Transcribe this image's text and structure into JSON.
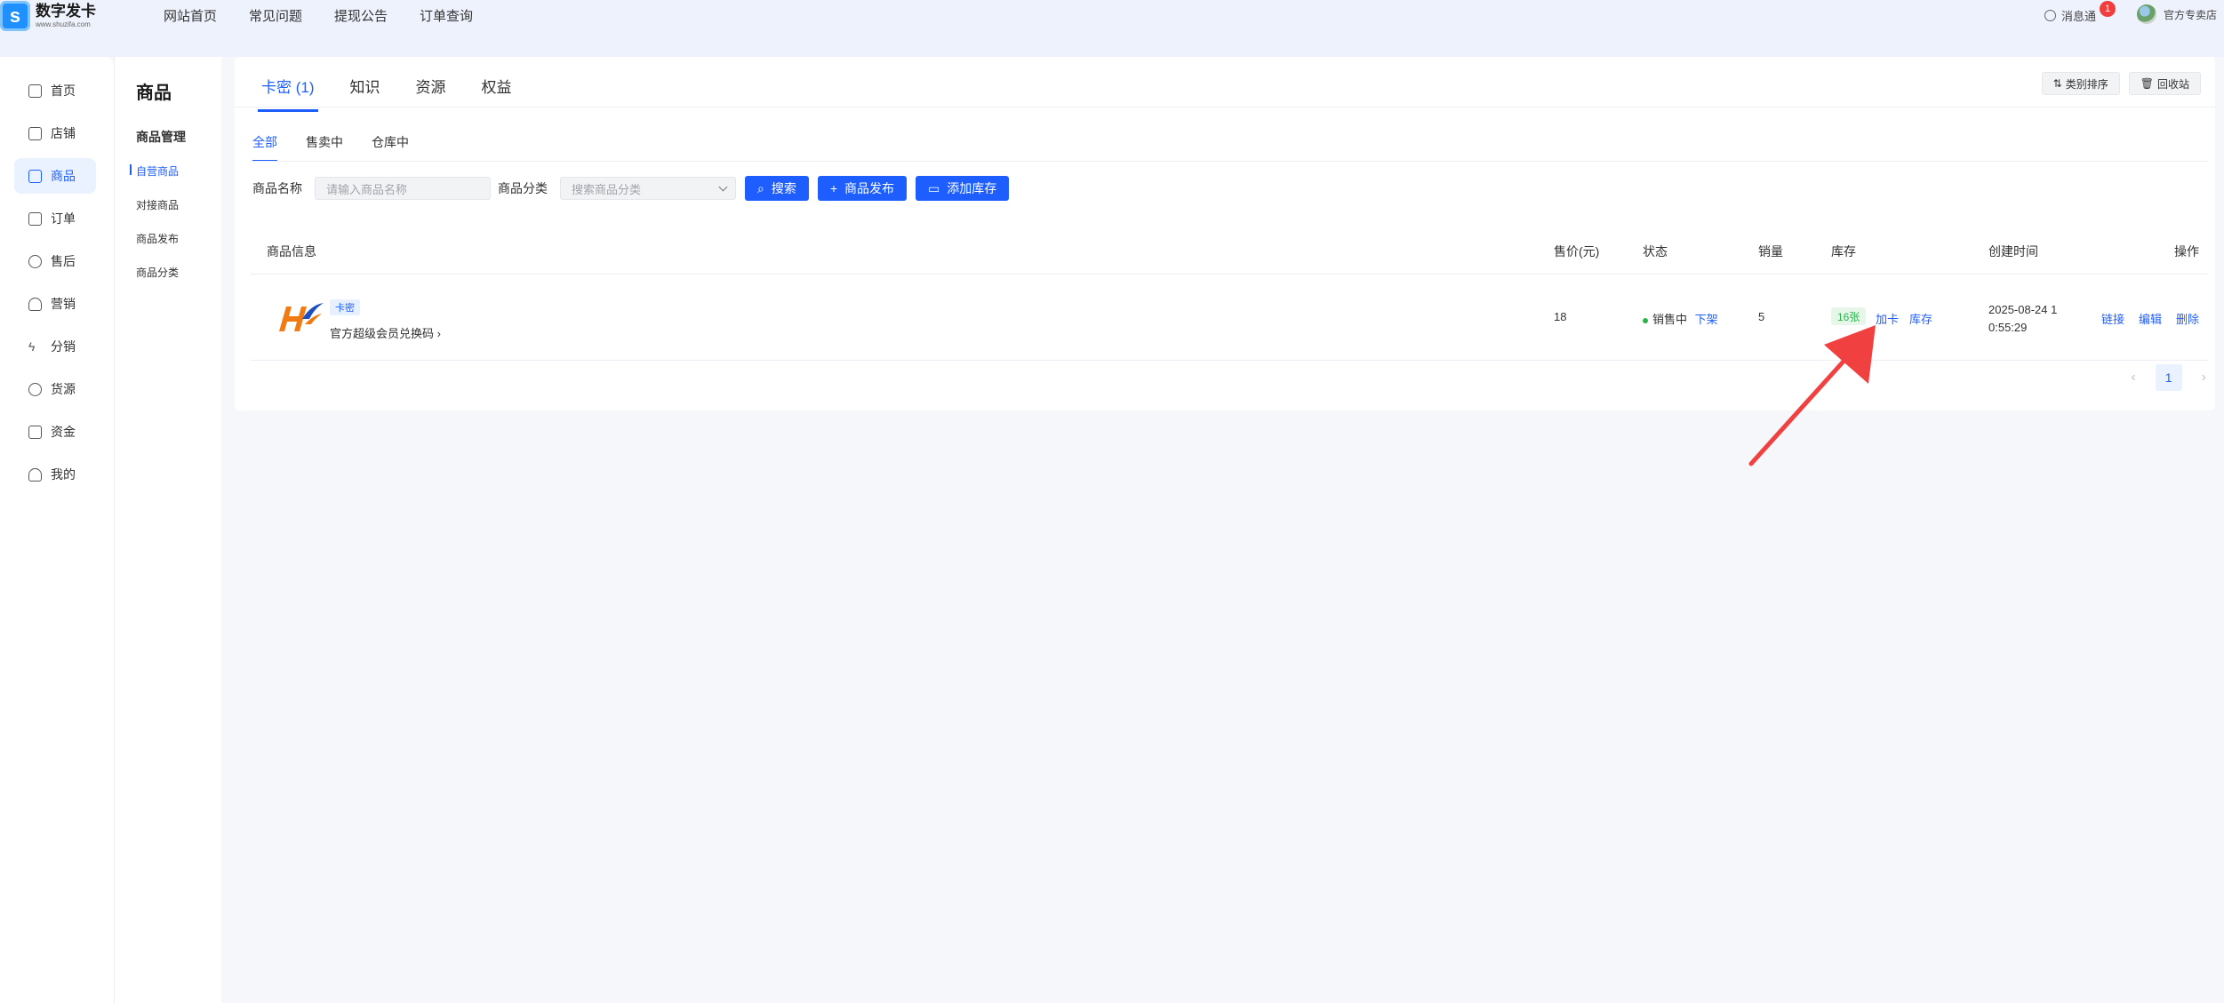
{
  "logo": {
    "mark": "s",
    "name": "数字发卡",
    "url": "www.shuzifa.com"
  },
  "topnav": [
    "网站首页",
    "常见问题",
    "提现公告",
    "订单查询"
  ],
  "header": {
    "messages_label": "消息通",
    "messages_badge": "1",
    "user_label": "官方专卖店"
  },
  "sidebar": {
    "items": [
      {
        "label": "首页",
        "icon": "home-icon"
      },
      {
        "label": "店铺",
        "icon": "store-icon"
      },
      {
        "label": "商品",
        "icon": "box-icon",
        "active": true
      },
      {
        "label": "订单",
        "icon": "order-icon"
      },
      {
        "label": "售后",
        "icon": "chat-icon"
      },
      {
        "label": "营销",
        "icon": "bulb-icon"
      },
      {
        "label": "分销",
        "icon": "bolt-icon"
      },
      {
        "label": "货源",
        "icon": "compass-icon"
      },
      {
        "label": "资金",
        "icon": "wallet-icon"
      },
      {
        "label": "我的",
        "icon": "user-icon"
      }
    ]
  },
  "subpanel": {
    "title": "商品",
    "group": "商品管理",
    "items": [
      "自营商品",
      "对接商品",
      "商品发布",
      "商品分类"
    ]
  },
  "main": {
    "tabs": [
      "卡密 (1)",
      "知识",
      "资源",
      "权益"
    ],
    "top_buttons": [
      "类别排序",
      "回收站"
    ],
    "subtabs": [
      "全部",
      "售卖中",
      "仓库中"
    ],
    "filters": {
      "name_label": "商品名称",
      "name_placeholder": "请输入商品名称",
      "category_label": "商品分类",
      "category_placeholder": "搜索商品分类",
      "search_button": "搜索",
      "publish_button": "商品发布",
      "add_stock_button": "添加库存"
    },
    "table": {
      "headers": [
        "商品信息",
        "售价(元)",
        "状态",
        "销量",
        "库存",
        "创建时间",
        "操作"
      ],
      "row": {
        "tag": "卡密",
        "name": "官方超级会员兑换码 ›",
        "price": "18",
        "status": "销售中",
        "status_action": "下架",
        "sales": "5",
        "stock": "16张",
        "add_card": "加卡",
        "stock_link": "库存",
        "created_line1": "2025-08-24 1",
        "created_line2": "0:55:29",
        "actions": [
          "链接",
          "编辑",
          "删除"
        ]
      }
    },
    "pagination": {
      "current": "1"
    }
  },
  "colors": {
    "primary": "#1e5eff",
    "success": "#2bb34a",
    "annotation_arrow": "#f04040"
  }
}
